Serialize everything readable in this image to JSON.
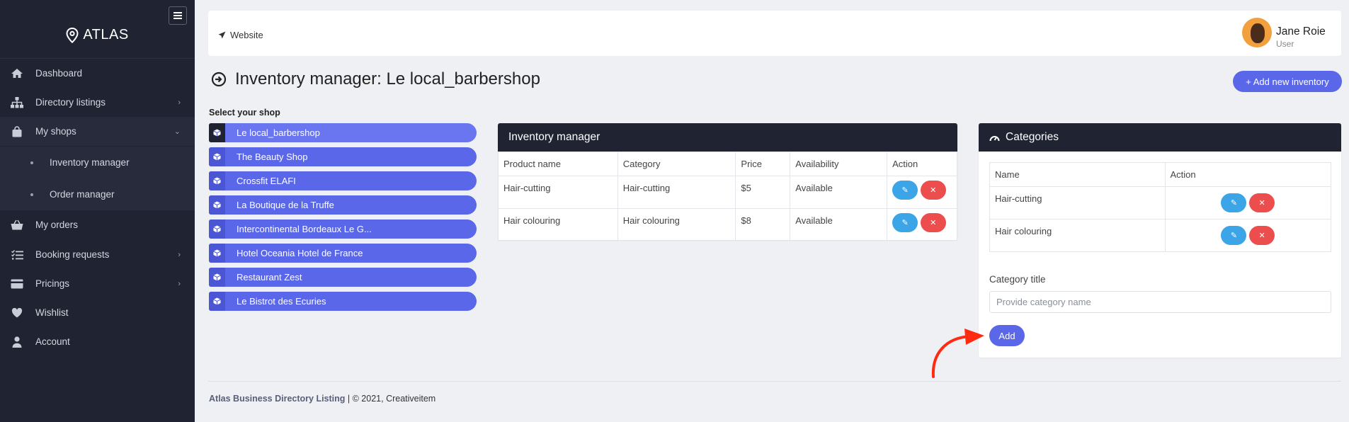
{
  "sidebar": {
    "brand": "ATLAS",
    "items": [
      {
        "label": "Dashboard",
        "icon": "home-icon"
      },
      {
        "label": "Directory listings",
        "icon": "sitemap-icon"
      },
      {
        "label": "My shops",
        "icon": "shopping-bag-icon"
      },
      {
        "label": "My orders",
        "icon": "basket-icon"
      },
      {
        "label": "Booking requests",
        "icon": "list-check-icon"
      },
      {
        "label": "Pricings",
        "icon": "credit-card-icon"
      },
      {
        "label": "Wishlist",
        "icon": "heart-icon"
      },
      {
        "label": "Account",
        "icon": "user-icon"
      }
    ],
    "subitems": [
      {
        "label": "Inventory manager"
      },
      {
        "label": "Order manager"
      }
    ]
  },
  "topbar": {
    "website_label": "Website",
    "user_name": "Jane Roie",
    "user_role": "User"
  },
  "page": {
    "title": "Inventory manager: Le local_barbershop",
    "add_button": "+ Add new inventory",
    "select_label": "Select your shop"
  },
  "shops": [
    "Le local_barbershop",
    "The Beauty Shop",
    "Crossfit ELAFI",
    "La Boutique de la Truffe",
    "Intercontinental Bordeaux Le G...",
    "Hotel Oceania Hotel de France",
    "Restaurant Zest",
    "Le Bistrot des Ecuries"
  ],
  "inventory": {
    "title": "Inventory manager",
    "headers": [
      "Product name",
      "Category",
      "Price",
      "Availability",
      "Action"
    ],
    "rows": [
      [
        "Hair-cutting",
        "Hair-cutting",
        "$5",
        "Available"
      ],
      [
        "Hair colouring",
        "Hair colouring",
        "$8",
        "Available"
      ]
    ]
  },
  "categories": {
    "title": "Categories",
    "headers": [
      "Name",
      "Action"
    ],
    "rows": [
      "Hair-cutting",
      "Hair colouring"
    ],
    "field_label": "Category title",
    "field_placeholder": "Provide category name",
    "add_label": "Add"
  },
  "footer": {
    "brand": "Atlas Business Directory Listing",
    "rest": "| © 2021, Creativeitem"
  },
  "colors": {
    "sidebar": "#202332",
    "accent": "#5a67e8",
    "edit": "#3ba5e8",
    "delete": "#ec4d4d",
    "annotation_arrow": "#ff2a12"
  }
}
